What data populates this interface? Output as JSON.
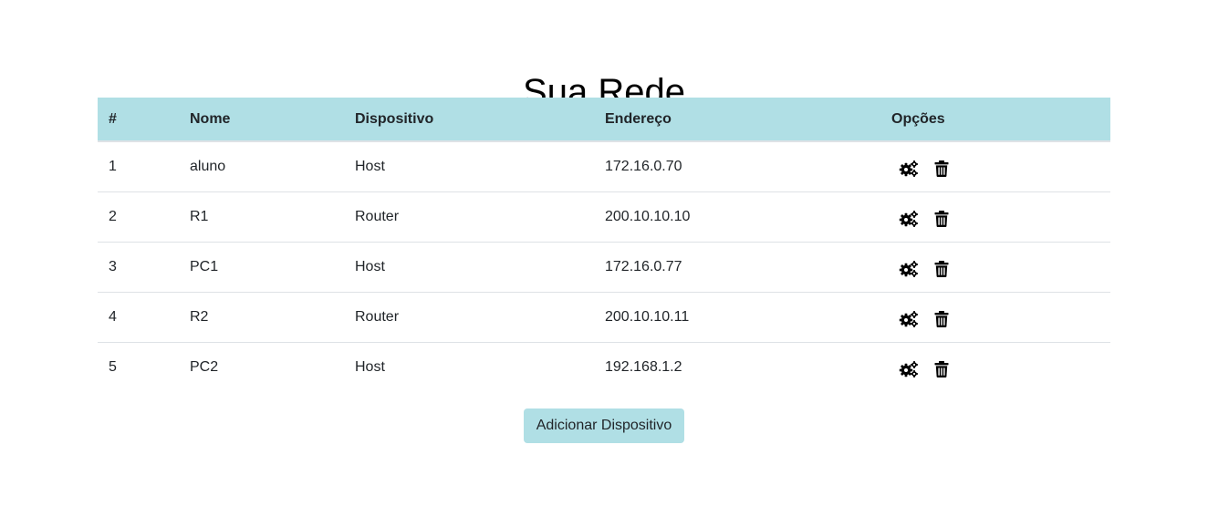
{
  "title": "Sua Rede",
  "table": {
    "headers": [
      "#",
      "Nome",
      "Dispositivo",
      "Endereço",
      "Opções"
    ],
    "rows": [
      {
        "num": "1",
        "name": "aluno",
        "device": "Host",
        "address": "172.16.0.70"
      },
      {
        "num": "2",
        "name": "R1",
        "device": "Router",
        "address": "200.10.10.10"
      },
      {
        "num": "3",
        "name": "PC1",
        "device": "Host",
        "address": "172.16.0.77"
      },
      {
        "num": "4",
        "name": "R2",
        "device": "Router",
        "address": "200.10.10.11"
      },
      {
        "num": "5",
        "name": "PC2",
        "device": "Host",
        "address": "192.168.1.2"
      }
    ],
    "row_actions": [
      {
        "icon": "gears-icon",
        "action": "configure"
      },
      {
        "icon": "trash-icon",
        "action": "delete"
      }
    ]
  },
  "add_button_label": "Adicionar Dispositivo",
  "colors": {
    "header_bg": "#b0dfe5",
    "button_bg": "#b0dfe5",
    "row_border": "#dee2e6"
  }
}
